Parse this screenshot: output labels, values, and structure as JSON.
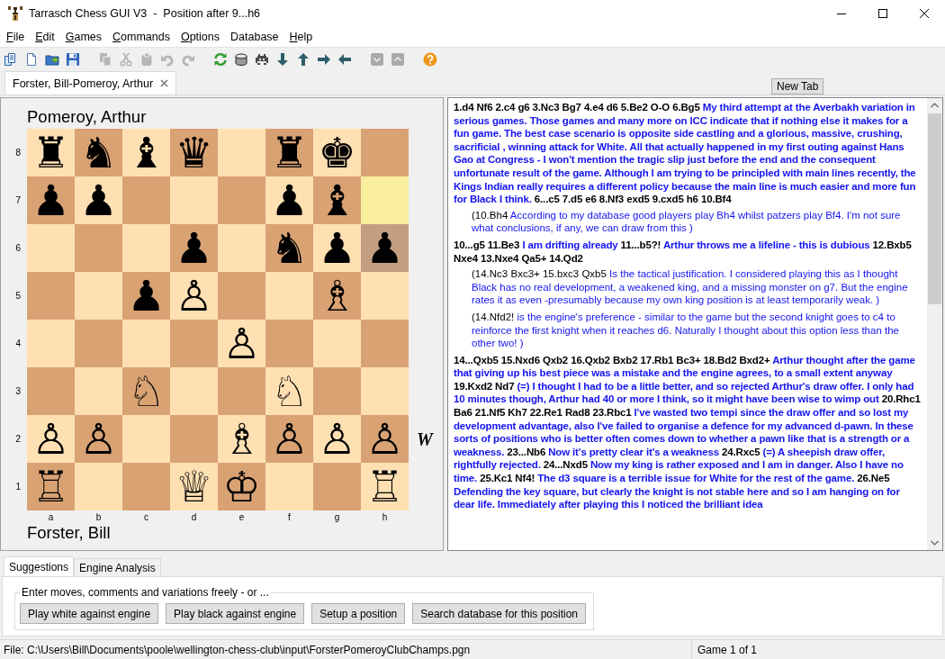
{
  "window": {
    "title": "Tarrasch Chess GUI V3  -  Position after 9...h6"
  },
  "menu": [
    {
      "label": "File",
      "mnemonic": true
    },
    {
      "label": "Edit",
      "mnemonic": true
    },
    {
      "label": "Games",
      "mnemonic": true
    },
    {
      "label": "Commands",
      "mnemonic": true
    },
    {
      "label": "Options",
      "mnemonic": true
    },
    {
      "label": "Database",
      "mnemonic": false
    },
    {
      "label": "Help",
      "mnemonic": true
    }
  ],
  "toolbar": [
    [
      {
        "kind": "pages",
        "disabled": false
      },
      {
        "kind": "document",
        "disabled": false
      },
      {
        "kind": "folder",
        "disabled": false
      },
      {
        "kind": "save",
        "disabled": false
      }
    ],
    [
      {
        "kind": "copy",
        "disabled": true
      },
      {
        "kind": "scissors",
        "disabled": true
      },
      {
        "kind": "paste",
        "disabled": true
      },
      {
        "kind": "undo",
        "disabled": true
      },
      {
        "kind": "redo",
        "disabled": true
      }
    ],
    [
      {
        "kind": "refresh",
        "disabled": false
      },
      {
        "kind": "cylinder",
        "disabled": false
      },
      {
        "kind": "invader",
        "disabled": false
      },
      {
        "kind": "arrow-down",
        "disabled": false
      },
      {
        "kind": "arrow-up",
        "disabled": false
      },
      {
        "kind": "arrow-right",
        "disabled": false
      },
      {
        "kind": "arrow-left",
        "disabled": false
      }
    ],
    [
      {
        "kind": "chevron-down",
        "disabled": false
      },
      {
        "kind": "chevron-up",
        "disabled": false
      }
    ],
    [
      {
        "kind": "help",
        "disabled": false
      }
    ]
  ],
  "game_tabs": [
    {
      "label": "Forster, Bill-Pomeroy, Arthur",
      "selected": true
    }
  ],
  "new_tab_button": "New Tab",
  "board": {
    "top_player": "Pomeroy, Arthur",
    "bottom_player": "Forster, Bill",
    "side_to_move": "W",
    "ranks": [
      {
        "label": "8",
        "squares": [
          {
            "dark": false,
            "piece": "♜"
          },
          {
            "dark": true,
            "piece": "♞"
          },
          {
            "dark": false,
            "piece": "♝"
          },
          {
            "dark": true,
            "piece": "♛"
          },
          {
            "dark": false
          },
          {
            "dark": true,
            "piece": "♜"
          },
          {
            "dark": false,
            "piece": "♚"
          },
          {
            "dark": true
          }
        ]
      },
      {
        "label": "7",
        "squares": [
          {
            "dark": true,
            "piece": "♟"
          },
          {
            "dark": false,
            "piece": "♟"
          },
          {
            "dark": true
          },
          {
            "dark": false
          },
          {
            "dark": true
          },
          {
            "dark": false,
            "piece": "♟"
          },
          {
            "dark": true,
            "piece": "♝"
          },
          {
            "dark": false,
            "highlighted": true
          }
        ]
      },
      {
        "label": "6",
        "squares": [
          {
            "dark": false
          },
          {
            "dark": true
          },
          {
            "dark": false
          },
          {
            "dark": true,
            "piece": "♟"
          },
          {
            "dark": false
          },
          {
            "dark": true,
            "piece": "♞"
          },
          {
            "dark": false,
            "piece": "♟"
          },
          {
            "dark": true,
            "highlighted": true,
            "piece": "♟"
          }
        ]
      },
      {
        "label": "5",
        "squares": [
          {
            "dark": true
          },
          {
            "dark": false
          },
          {
            "dark": true,
            "piece": "♟"
          },
          {
            "dark": false,
            "piece": "♙"
          },
          {
            "dark": true
          },
          {
            "dark": false
          },
          {
            "dark": true,
            "piece": "♗"
          },
          {
            "dark": false
          }
        ]
      },
      {
        "label": "4",
        "squares": [
          {
            "dark": false
          },
          {
            "dark": true
          },
          {
            "dark": false
          },
          {
            "dark": true
          },
          {
            "dark": false,
            "piece": "♙"
          },
          {
            "dark": true
          },
          {
            "dark": false
          },
          {
            "dark": true
          }
        ]
      },
      {
        "label": "3",
        "squares": [
          {
            "dark": true
          },
          {
            "dark": false
          },
          {
            "dark": true,
            "piece": "♘"
          },
          {
            "dark": false
          },
          {
            "dark": true
          },
          {
            "dark": false,
            "piece": "♘"
          },
          {
            "dark": true
          },
          {
            "dark": false
          }
        ]
      },
      {
        "label": "2",
        "squares": [
          {
            "dark": false,
            "piece": "♙"
          },
          {
            "dark": true,
            "piece": "♙"
          },
          {
            "dark": false
          },
          {
            "dark": true
          },
          {
            "dark": false,
            "piece": "♗"
          },
          {
            "dark": true,
            "piece": "♙"
          },
          {
            "dark": false,
            "piece": "♙"
          },
          {
            "dark": true,
            "piece": "♙"
          }
        ]
      },
      {
        "label": "1",
        "squares": [
          {
            "dark": true,
            "piece": "♖"
          },
          {
            "dark": false
          },
          {
            "dark": true
          },
          {
            "dark": false,
            "piece": "♕"
          },
          {
            "dark": true,
            "piece": "♔"
          },
          {
            "dark": false
          },
          {
            "dark": true
          },
          {
            "dark": false,
            "piece": "♖"
          }
        ]
      }
    ],
    "files": [
      "a",
      "b",
      "c",
      "d",
      "e",
      "f",
      "g",
      "h"
    ]
  },
  "game_text": [
    {
      "kind": "main",
      "segments": [
        {
          "kind": "move",
          "text": "1.d4 Nf6 2.c4 g6 3.Nc3 Bg7 4.e4 d6 5.Be2 O-O 6.Bg5"
        },
        {
          "kind": "comment",
          "text": "My third attempt at the Averbakh variation in serious games. Those games and many more on ICC indicate that if nothing else it makes for a fun game. The best case scenario is opposite side castling and a glorious, massive, crushing, sacrificial , winning attack for White. All that actually happened in my first outing against Hans Gao at Congress - I won't mention the tragic slip just before the end and the consequent unfortunate result of the game. Although I am trying to be principled with main lines recently, the Kings Indian really requires a different policy because the main line is much easier and more fun for Black I think."
        },
        {
          "kind": "move",
          "text": "6...c5 7.d5 e6 8.Nf3 exd5 9.cxd5 h6 10.Bf4"
        }
      ]
    },
    {
      "kind": "variation",
      "segments": [
        {
          "kind": "move",
          "text": "(10.Bh4"
        },
        {
          "kind": "comment",
          "text": "According to my database good players play Bh4 whilst patzers play Bf4. I'm not sure what conclusions, if any, we can draw from this )"
        }
      ]
    },
    {
      "kind": "main",
      "segments": [
        {
          "kind": "move",
          "text": "10...g5 11.Be3"
        },
        {
          "kind": "comment",
          "text": "I am drifting already"
        },
        {
          "kind": "move",
          "text": "11...b5?!"
        },
        {
          "kind": "comment",
          "text": "Arthur throws me a lifeline - this is dubious"
        },
        {
          "kind": "move",
          "text": "12.Bxb5 Nxe4 13.Nxe4 Qa5+ 14.Qd2"
        }
      ]
    },
    {
      "kind": "variation",
      "segments": [
        {
          "kind": "move",
          "text": "(14.Nc3 Bxc3+ 15.bxc3 Qxb5"
        },
        {
          "kind": "comment",
          "text": "Is the tactical justification. I considered playing this as I thought Black has no real development, a weakened king, and a missing monster on g7. But the engine rates it as even -presumably because my own king position is at least temporarily weak. )"
        }
      ]
    },
    {
      "kind": "variation",
      "segments": [
        {
          "kind": "move",
          "text": "(14.Nfd2!"
        },
        {
          "kind": "comment",
          "text": "is the engine's preference - similar to the game but the second knight goes to c4 to reinforce the first knight when it reaches d6. Naturally I thought about this option less than the other two! )"
        }
      ]
    },
    {
      "kind": "main",
      "segments": [
        {
          "kind": "move",
          "text": "14...Qxb5 15.Nxd6 Qxb2 16.Qxb2 Bxb2 17.Rb1 Bc3+ 18.Bd2 Bxd2+"
        },
        {
          "kind": "comment",
          "text": "Arthur thought after the game that giving up his best piece was a mistake and the engine agrees, to a small extent anyway"
        },
        {
          "kind": "move",
          "text": "19.Kxd2 Nd7"
        },
        {
          "kind": "comment",
          "text": "(=) I thought I had to be a little better, and so rejected Arthur's draw offer. I only had 10 minutes though, Arthur had 40 or more I think, so it might have been wise to wimp out"
        },
        {
          "kind": "move",
          "text": "20.Rhc1 Ba6 21.Nf5 Kh7 22.Re1 Rad8 23.Rbc1"
        },
        {
          "kind": "comment",
          "text": "I've wasted two tempi since the draw offer and so lost my development advantage, also I've failed to organise a defence for my advanced d-pawn. In these sorts of positions who is better often comes down to whether a pawn like that is a strength or a weakness."
        },
        {
          "kind": "move",
          "text": "23...Nb6"
        },
        {
          "kind": "comment",
          "text": "Now it's pretty clear it's a weakness"
        },
        {
          "kind": "move",
          "text": "24.Rxc5"
        },
        {
          "kind": "comment",
          "text": "(=) A sheepish draw offer, rightfully rejected."
        },
        {
          "kind": "move",
          "text": "24...Nxd5"
        },
        {
          "kind": "comment",
          "text": "Now my king is rather exposed and I am in danger. Also I have no time."
        },
        {
          "kind": "move",
          "text": "25.Kc1 Nf4!"
        },
        {
          "kind": "comment",
          "text": "The d3 square is a terrible issue for White for the rest of the game."
        },
        {
          "kind": "move",
          "text": "26.Ne5"
        },
        {
          "kind": "comment",
          "text": "Defending the key square, but clearly the knight is not stable here and so I am hanging on for dear life. Immediately after playing this I noticed the brilliant idea"
        }
      ]
    }
  ],
  "bottom_tabs": [
    {
      "label": "Suggestions",
      "selected": true
    },
    {
      "label": "Engine Analysis",
      "selected": false
    }
  ],
  "suggestions": {
    "legend": "Enter moves, comments and variations freely - or ...",
    "buttons": [
      "Play white against engine",
      "Play black against engine",
      "Setup a position",
      "Search database for this position"
    ]
  },
  "status_bar": {
    "file": "File: C:\\Users\\Bill\\Documents\\poole\\wellington-chess-club\\input\\ForsterPomeroyClubChamps.pgn",
    "game": "Game 1 of 1"
  }
}
